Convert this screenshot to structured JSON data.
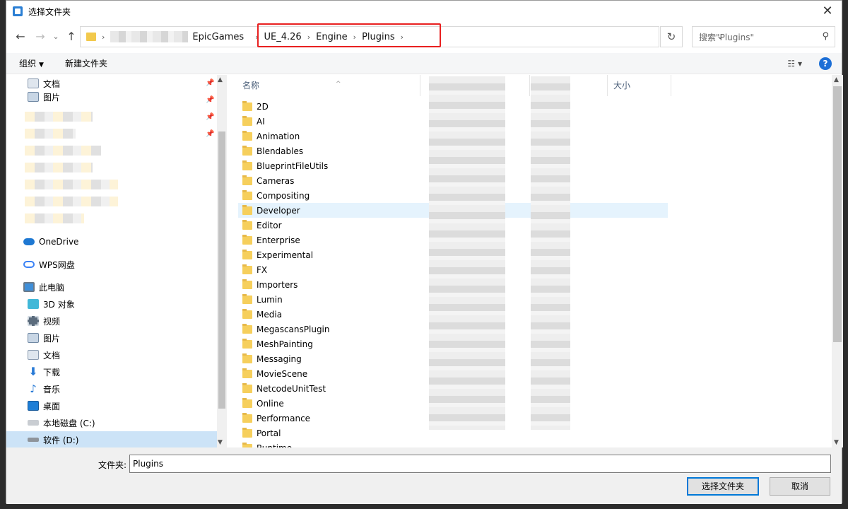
{
  "window": {
    "title": "选择文件夹",
    "close": "✕"
  },
  "nav": {
    "back": "←",
    "forward": "→",
    "recent": "⌄",
    "up": "↑",
    "refresh": "↻",
    "dropdown": "⌄"
  },
  "address": {
    "crumbs": [
      "EpicGames",
      "UE_4.26",
      "Engine",
      "Plugins"
    ],
    "sep": "›"
  },
  "search": {
    "placeholder": "搜索\"Plugins\"",
    "icon": "⚲"
  },
  "toolbar": {
    "organize": "组织",
    "new_folder": "新建文件夹",
    "view": "☷ ▾",
    "help": "?"
  },
  "sidebar": {
    "quick": [
      {
        "label": "文档",
        "icon": "document-icon"
      },
      {
        "label": "图片",
        "icon": "picture-icon"
      }
    ],
    "onedrive": "OneDrive",
    "wps": "WPS网盘",
    "thispc": "此电脑",
    "pc_items": [
      {
        "label": "3D 对象",
        "icon": "3d-objects-icon"
      },
      {
        "label": "视频",
        "icon": "video-icon"
      },
      {
        "label": "图片",
        "icon": "picture-icon"
      },
      {
        "label": "文档",
        "icon": "document-icon"
      },
      {
        "label": "下载",
        "icon": "download-icon"
      },
      {
        "label": "音乐",
        "icon": "music-icon"
      },
      {
        "label": "桌面",
        "icon": "desktop-icon"
      },
      {
        "label": "本地磁盘 (C:)",
        "icon": "drive-icon"
      },
      {
        "label": "软件 (D:)",
        "icon": "drive-icon"
      }
    ]
  },
  "columns": {
    "name": "名称",
    "size": "大小"
  },
  "folders": [
    "2D",
    "AI",
    "Animation",
    "Blendables",
    "BlueprintFileUtils",
    "Cameras",
    "Compositing",
    "Developer",
    "Editor",
    "Enterprise",
    "Experimental",
    "FX",
    "Importers",
    "Lumin",
    "Media",
    "MegascansPlugin",
    "MeshPainting",
    "Messaging",
    "MovieScene",
    "NetcodeUnitTest",
    "Online",
    "Performance",
    "Portal",
    "Runtime"
  ],
  "selected_folder": "Developer",
  "footer": {
    "folder_label": "文件夹:",
    "folder_value": "Plugins",
    "select_button": "选择文件夹",
    "cancel_button": "取消"
  },
  "colors": {
    "accent": "#0078d7",
    "highlight_box": "#e82020",
    "selection": "#cce3f7"
  }
}
